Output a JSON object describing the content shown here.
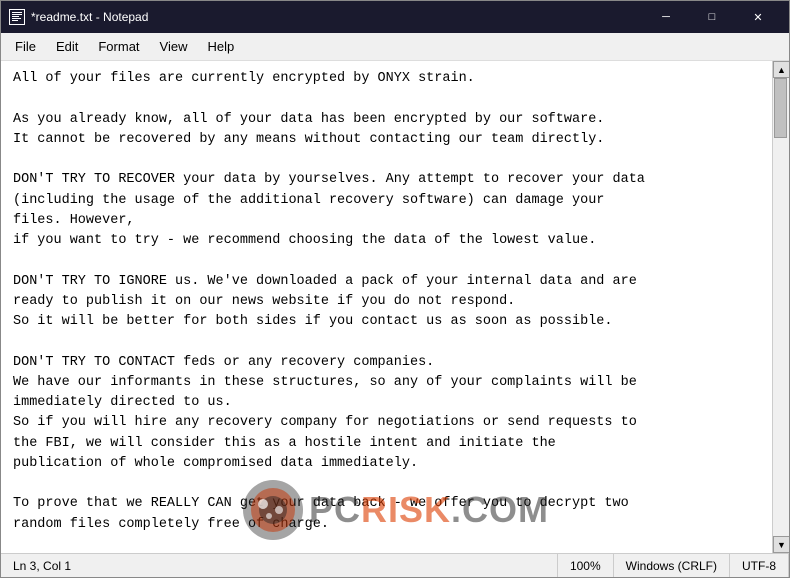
{
  "window": {
    "title": "*readme.txt - Notepad",
    "icon": "notepad-icon"
  },
  "title_controls": {
    "minimize": "─",
    "maximize": "□",
    "close": "✕"
  },
  "menu": {
    "items": [
      "File",
      "Edit",
      "Format",
      "View",
      "Help"
    ]
  },
  "content": {
    "text": "All of your files are currently encrypted by ONYX strain.\n\nAs you already know, all of your data has been encrypted by our software.\nIt cannot be recovered by any means without contacting our team directly.\n\nDON'T TRY TO RECOVER your data by yourselves. Any attempt to recover your data\n(including the usage of the additional recovery software) can damage your\nfiles. However,\nif you want to try - we recommend choosing the data of the lowest value.\n\nDON'T TRY TO IGNORE us. We've downloaded a pack of your internal data and are\nready to publish it on our news website if you do not respond.\nSo it will be better for both sides if you contact us as soon as possible.\n\nDON'T TRY TO CONTACT feds or any recovery companies.\nWe have our informants in these structures, so any of your complaints will be\nimmediately directed to us.\nSo if you will hire any recovery company for negotiations or send requests to\nthe FBI, we will consider this as a hostile intent and initiate the\npublication of whole compromised data immediately.\n\nTo prove that we REALLY CAN get your data back - we offer you to decrypt two\nrandom files completely free of charge."
  },
  "status_bar": {
    "position": "Ln 3, Col 1",
    "zoom": "100%",
    "line_ending": "Windows (CRLF)",
    "encoding": "UTF-8"
  },
  "watermark": {
    "text_pc": "PC",
    "text_risk": "RISK",
    "text_com": ".COM"
  }
}
